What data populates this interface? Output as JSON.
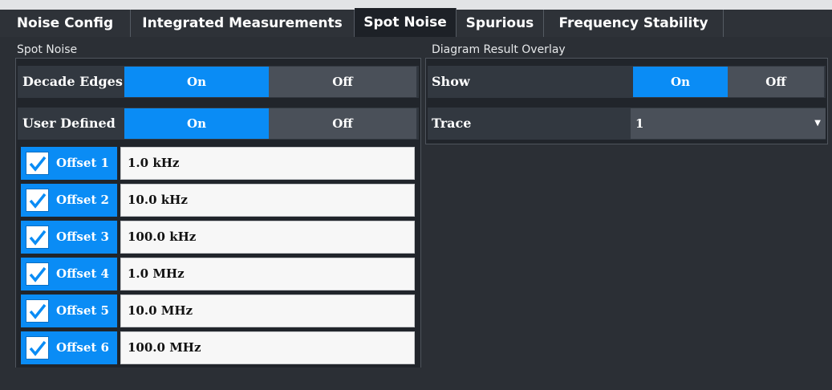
{
  "tabs": [
    {
      "label": "Noise Config",
      "active": false
    },
    {
      "label": "Integrated Measurements",
      "active": false
    },
    {
      "label": "Spot Noise",
      "active": true
    },
    {
      "label": "Spurious",
      "active": false
    },
    {
      "label": "Frequency Stability",
      "active": false
    }
  ],
  "spot_noise": {
    "title": "Spot Noise",
    "decade_edges": {
      "label": "Decade Edges",
      "on_label": "On",
      "off_label": "Off",
      "value": "On"
    },
    "user_defined": {
      "label": "User Defined",
      "on_label": "On",
      "off_label": "Off",
      "value": "On"
    },
    "offsets": [
      {
        "label": "Offset 1",
        "checked": true,
        "value": "1.0 kHz"
      },
      {
        "label": "Offset 2",
        "checked": true,
        "value": "10.0 kHz"
      },
      {
        "label": "Offset 3",
        "checked": true,
        "value": "100.0 kHz"
      },
      {
        "label": "Offset 4",
        "checked": true,
        "value": "1.0 MHz"
      },
      {
        "label": "Offset 5",
        "checked": true,
        "value": "10.0 MHz"
      },
      {
        "label": "Offset 6",
        "checked": true,
        "value": "100.0 MHz"
      }
    ]
  },
  "overlay": {
    "title": "Diagram Result Overlay",
    "show": {
      "label": "Show",
      "on_label": "On",
      "off_label": "Off",
      "value": "On"
    },
    "trace": {
      "label": "Trace",
      "value": "1"
    }
  },
  "colors": {
    "accent": "#0a8cf5",
    "panel": "#21252b",
    "background": "#2b2f35"
  }
}
